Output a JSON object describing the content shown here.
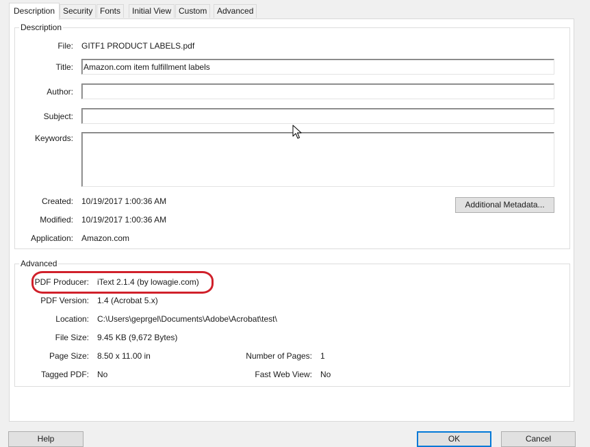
{
  "tabs": [
    "Description",
    "Security",
    "Fonts",
    "Initial View",
    "Custom",
    "Advanced"
  ],
  "description": {
    "group_title": "Description",
    "file_label": "File:",
    "file_value": "GITF1 PRODUCT LABELS.pdf",
    "title_label": "Title:",
    "title_value": "Amazon.com item fulfillment labels",
    "author_label": "Author:",
    "author_value": "",
    "subject_label": "Subject:",
    "subject_value": "",
    "keywords_label": "Keywords:",
    "keywords_value": "",
    "created_label": "Created:",
    "created_value": "10/19/2017 1:00:36 AM",
    "modified_label": "Modified:",
    "modified_value": "10/19/2017 1:00:36 AM",
    "application_label": "Application:",
    "application_value": "Amazon.com",
    "additional_metadata_label": "Additional Metadata..."
  },
  "advanced": {
    "group_title": "Advanced",
    "producer_label": "PDF Producer:",
    "producer_value": "iText 2.1.4 (by lowagie.com)",
    "version_label": "PDF Version:",
    "version_value": "1.4 (Acrobat 5.x)",
    "location_label": "Location:",
    "location_value": "C:\\Users\\geprgel\\Documents\\Adobe\\Acrobat\\test\\",
    "filesize_label": "File Size:",
    "filesize_value": "9.45 KB (9,672 Bytes)",
    "pagesize_label": "Page Size:",
    "pagesize_value": "8.50 x 11.00 in",
    "numpages_label": "Number of Pages:",
    "numpages_value": "1",
    "tagged_label": "Tagged PDF:",
    "tagged_value": "No",
    "fastweb_label": "Fast Web View:",
    "fastweb_value": "No"
  },
  "footer": {
    "help_label": "Help",
    "ok_label": "OK",
    "cancel_label": "Cancel"
  },
  "colors": {
    "highlight": "#d0202a",
    "default_button_border": "#0078d7"
  },
  "icons": {
    "cursor": "mouse-pointer-icon"
  }
}
